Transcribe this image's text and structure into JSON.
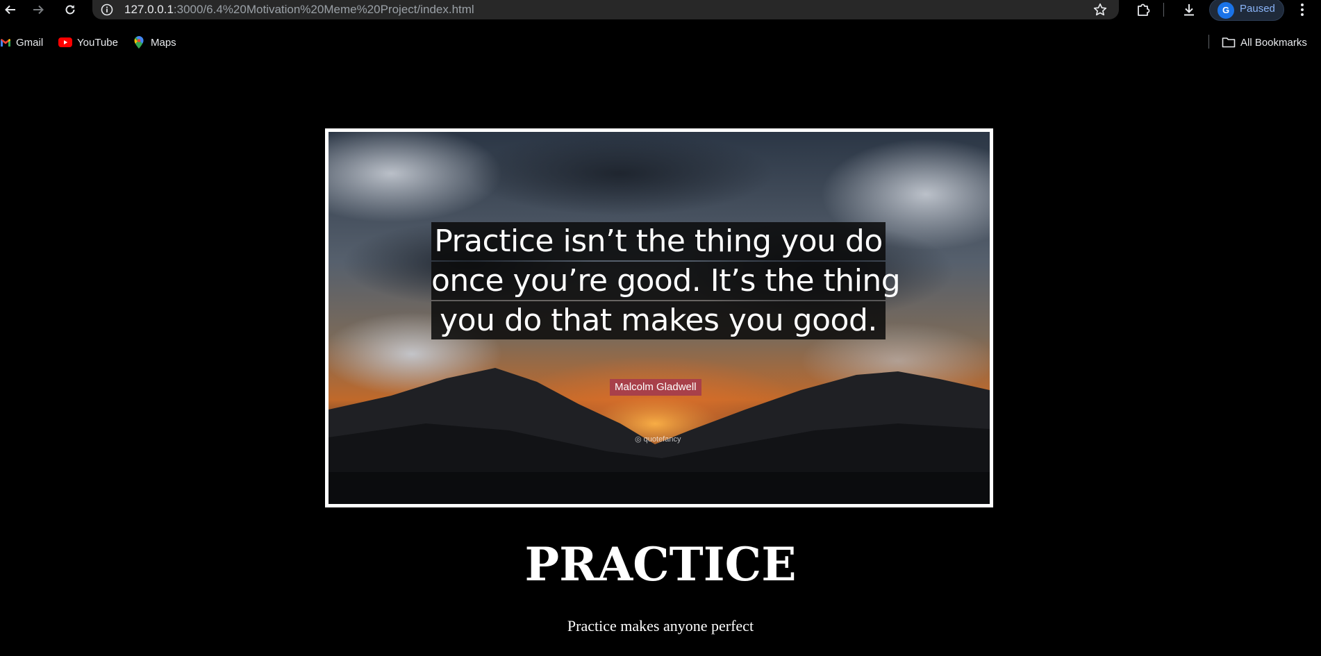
{
  "browser": {
    "url_host": "127.0.0.1",
    "url_path": ":3000/6.4%20Motivation%20Meme%20Project/index.html",
    "profile_initial": "G",
    "profile_status": "Paused",
    "icons": {
      "back": "arrow-left-icon",
      "forward": "arrow-right-icon",
      "reload": "reload-icon",
      "site_info": "info-icon",
      "bookmark": "star-icon",
      "extensions": "puzzle-icon",
      "downloads": "download-icon",
      "menu": "three-dots-icon"
    },
    "accent": "#8ab4f8"
  },
  "bookmarks": {
    "items": [
      {
        "label": "Gmail",
        "icon": "gmail-icon"
      },
      {
        "label": "YouTube",
        "icon": "youtube-icon"
      },
      {
        "label": "Maps",
        "icon": "maps-icon"
      }
    ],
    "all_bookmarks": "All Bookmarks"
  },
  "meme": {
    "quote_lines": [
      "Practice isn’t the thing you do",
      "once you’re good. It’s the thing",
      "you do that makes you good."
    ],
    "author": "Malcolm Gladwell",
    "watermark": "quotefancy",
    "author_color": "#a8404a"
  },
  "page": {
    "title": "PRACTICE",
    "subtitle": "Practice makes anyone perfect"
  }
}
